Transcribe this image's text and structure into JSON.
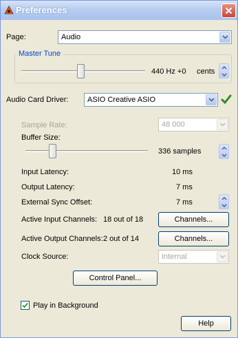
{
  "window": {
    "title": "Preferences"
  },
  "page": {
    "label": "Page:",
    "value": "Audio"
  },
  "master_tune": {
    "title": "Master Tune",
    "value": "440 Hz +0",
    "unit": "cents",
    "level": 0.48
  },
  "driver": {
    "label": "Audio Card Driver:",
    "value": "ASIO Creative ASIO"
  },
  "sample_rate": {
    "label": "Sample Rate:",
    "value": "48 000"
  },
  "buffer": {
    "label": "Buffer Size:",
    "value": "336 samples",
    "level": 0.22
  },
  "latency": {
    "input_label": "Input Latency:",
    "input_value": "10 ms",
    "output_label": "Output Latency:",
    "output_value": "7 ms",
    "sync_label": "External Sync Offset:",
    "sync_value": "7 ms"
  },
  "channels": {
    "input_label": "Active Input Channels:",
    "input_value": "18 out of 18",
    "input_button": "Channels...",
    "output_label": "Active Output Channels:",
    "output_value": "2 out of 14",
    "output_button": "Channels..."
  },
  "clock": {
    "label": "Clock Source:",
    "value": "Internal"
  },
  "control_panel_button": "Control Panel...",
  "play_background": {
    "label": "Play in Background",
    "checked": true
  },
  "help_button": "Help"
}
